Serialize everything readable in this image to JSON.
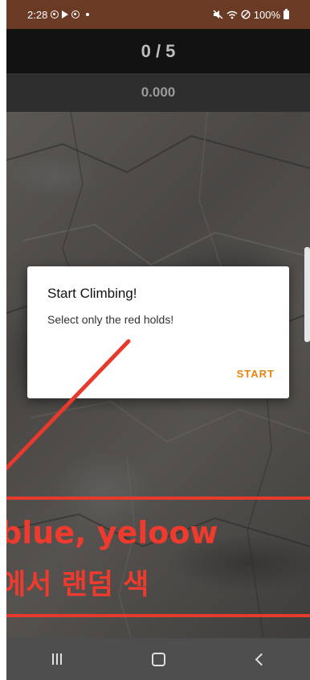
{
  "status_bar": {
    "time": "2:28",
    "battery": "100%",
    "icons": [
      "record-icon",
      "play-icon",
      "record-icon",
      "dot-icon",
      "mute-icon",
      "wifi-icon",
      "no-signal-icon",
      "battery-icon"
    ]
  },
  "score": {
    "text": "0 / 5"
  },
  "timer": {
    "text": "0.000"
  },
  "dialog": {
    "title": "Start Climbing!",
    "message": "Select only the red holds!",
    "button_label": "START",
    "accent_color": "#e8830e"
  },
  "annotation": {
    "line1": "blue, yeloow",
    "line2": "에서 랜덤 색",
    "color": "#ee3b2e"
  },
  "nav_bar": {
    "icons": [
      "recents-icon",
      "home-icon",
      "back-icon"
    ]
  }
}
